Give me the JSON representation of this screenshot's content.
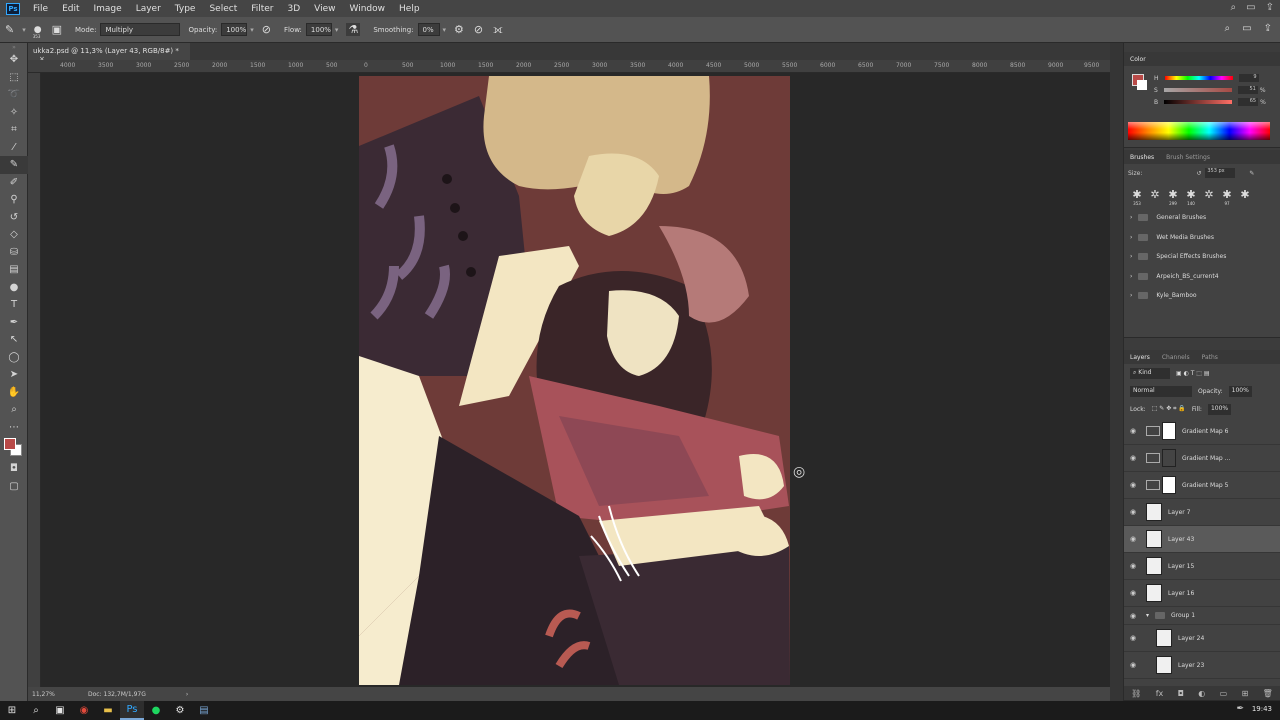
{
  "app": {
    "logo": "Ps"
  },
  "menubar": {
    "items": [
      "File",
      "Edit",
      "Image",
      "Layer",
      "Type",
      "Select",
      "Filter",
      "3D",
      "View",
      "Window",
      "Help"
    ],
    "right_icons": [
      "search-icon",
      "workspace-icon",
      "share-icon"
    ]
  },
  "options": {
    "brush_size": "353",
    "mode_label": "Mode:",
    "mode_value": "Multiply",
    "opacity_label": "Opacity:",
    "opacity_value": "100%",
    "flow_label": "Flow:",
    "flow_value": "100%",
    "smoothing_label": "Smoothing:",
    "smoothing_value": "0%"
  },
  "document": {
    "tab_title": "ukka2.psd @ 11,3% (Layer 43, RGB/8#) *",
    "zoom": "11,27%",
    "doc_info": "Doc: 132,7M/1,97G"
  },
  "ruler": {
    "ticks": [
      "4000",
      "3500",
      "3000",
      "2500",
      "2000",
      "1500",
      "1000",
      "500",
      "0",
      "500",
      "1000",
      "1500",
      "2000",
      "2500",
      "3000",
      "3500",
      "4000",
      "4500",
      "5000",
      "5500",
      "6000",
      "6500",
      "7000",
      "7500",
      "8000",
      "8500",
      "9000",
      "9500"
    ]
  },
  "color_panel": {
    "title": "Color",
    "h_label": "H",
    "h_value": "9",
    "s_label": "S",
    "s_value": "51",
    "b_label": "B",
    "b_value": "65",
    "percent": "%",
    "foreground_color": "#b94a48",
    "background_color": "#ffffff"
  },
  "brush_panel": {
    "tabs": [
      "Brushes",
      "Brush Settings"
    ],
    "size_label": "Size:",
    "size_value": "353 px",
    "preset_sizes": [
      "353",
      "",
      "299",
      "140",
      "",
      "97",
      ""
    ],
    "folders": [
      "General Brushes",
      "Wet Media Brushes",
      "Special Effects Brushes",
      "Arpeich_BS_current4",
      "Kyle_Bamboo"
    ]
  },
  "layers_panel": {
    "tabs": [
      "Layers",
      "Channels",
      "Paths"
    ],
    "filter": "Kind",
    "blend_mode": "Normal",
    "opacity_label": "Opacity:",
    "opacity_value": "100%",
    "lock_label": "Lock:",
    "fill_label": "Fill:",
    "fill_value": "100%",
    "layers": [
      {
        "name": "Gradient Map 6",
        "type": "adjustment",
        "selected": false
      },
      {
        "name": "Gradient Map ...",
        "type": "adjustment",
        "selected": false
      },
      {
        "name": "Gradient Map 5",
        "type": "adjustment",
        "selected": false
      },
      {
        "name": "Layer 7",
        "type": "pixel",
        "selected": false
      },
      {
        "name": "Layer 43",
        "type": "pixel",
        "selected": true
      },
      {
        "name": "Layer 15",
        "type": "pixel",
        "selected": false
      },
      {
        "name": "Layer 16",
        "type": "pixel",
        "selected": false
      }
    ],
    "group": {
      "name": "Group 1"
    },
    "group_layers": [
      {
        "name": "Layer 24"
      },
      {
        "name": "Layer 23"
      }
    ]
  },
  "taskbar": {
    "clock": "19:43"
  }
}
